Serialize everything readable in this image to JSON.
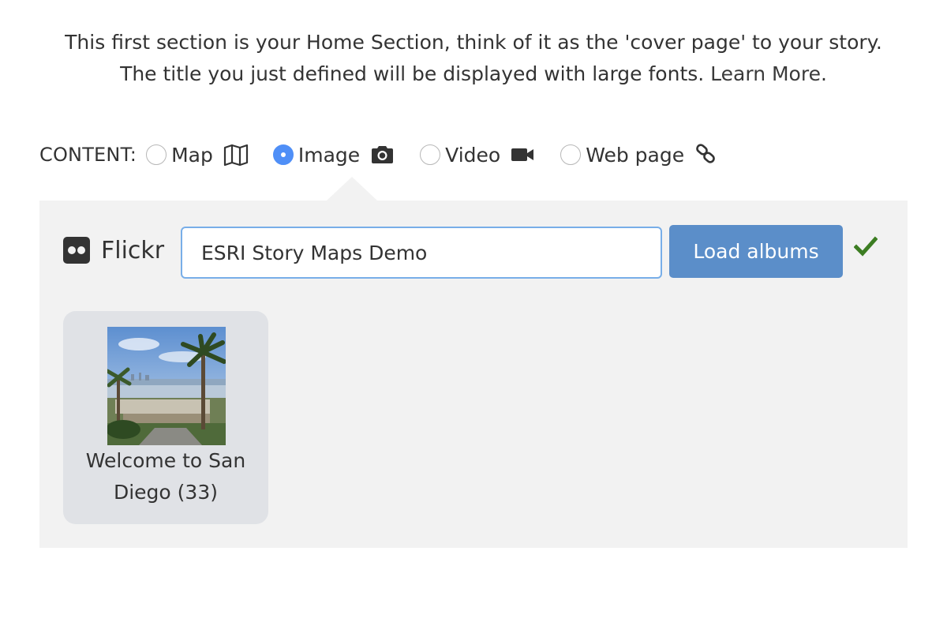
{
  "intro": {
    "line1": "This first section is your Home Section, think of it as the 'cover page' to your story.",
    "line2": "The title you just defined will be displayed with large fonts.",
    "learn_more": "Learn More",
    "period": "."
  },
  "content": {
    "label": "CONTENT:",
    "options": [
      {
        "label": "Map",
        "icon": "map-icon",
        "checked": false
      },
      {
        "label": "Image",
        "icon": "camera-icon",
        "checked": true
      },
      {
        "label": "Video",
        "icon": "video-camera-icon",
        "checked": false
      },
      {
        "label": "Web page",
        "icon": "link-icon",
        "checked": false
      }
    ]
  },
  "flickr": {
    "label": "Flickr",
    "input_value": "ESRI Story Maps Demo",
    "load_button": "Load albums",
    "status_icon": "checkmark-icon",
    "status_color": "#3c7d22"
  },
  "albums": [
    {
      "line1": "Welcome to San",
      "line2": "Diego (33)"
    }
  ],
  "colors": {
    "accent_radio": "#4f8ff7",
    "button": "#5b8ec9",
    "panel_bg": "#f2f2f2",
    "card_bg": "#e0e2e6"
  }
}
